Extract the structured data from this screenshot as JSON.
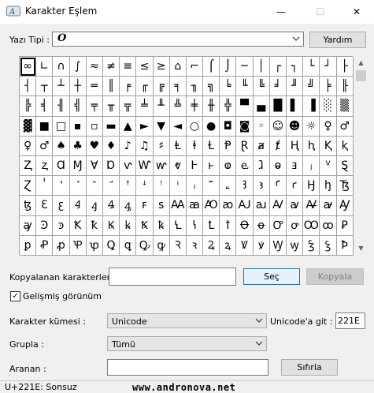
{
  "window": {
    "title": "Karakter Eşlem",
    "minimize": "—",
    "maximize": "☐",
    "close": "✕"
  },
  "font_row": {
    "label": "Yazı Tipi :",
    "font_value": "O",
    "help_button": "Yardım"
  },
  "grid": {
    "selected_index": 0,
    "chars": [
      "∞",
      "∟",
      "∩",
      "∫",
      "≈",
      "≠",
      "≡",
      "≤",
      "≥",
      "⌂",
      "⌐",
      "⌠",
      "⌡",
      "─",
      "│",
      "┌",
      "┐",
      "└",
      "┘",
      "├",
      "┤",
      "┬",
      "┴",
      "┼",
      "═",
      "║",
      "╒",
      "╓",
      "╔",
      "╕",
      "╖",
      "╗",
      "╘",
      "╙",
      "╚",
      "╛",
      "╜",
      "╝",
      "╞",
      "╟",
      "╠",
      "╡",
      "╢",
      "╣",
      "╤",
      "╥",
      "╦",
      "╧",
      "╨",
      "╩",
      "╪",
      "╫",
      "╬",
      "▀",
      "▄",
      "█",
      "▌",
      "▐",
      "░",
      "▒",
      "▓",
      "■",
      "□",
      "▪",
      "▫",
      "▬",
      "▲",
      "►",
      "▼",
      "◄",
      "○",
      "●",
      "◘",
      "◙",
      "◦",
      "☺",
      "☻",
      "☼",
      "♀",
      "♂",
      "♀",
      "♂",
      "♠",
      "♣",
      "♥",
      "♦",
      "♪",
      "♫",
      "♯",
      "Ⱡ",
      "ⱡ",
      "Ɫ",
      "Ᵽ",
      "Ɽ",
      "ⱥ",
      "ⱦ",
      "Ⱨ",
      "ⱨ",
      "Ⱪ",
      "ⱪ",
      "Ⱬ",
      "ⱬ",
      "Ɑ",
      "Ɱ",
      "Ɐ",
      "Ɒ",
      "ⱱ",
      "Ⱳ",
      "ⱳ",
      "ⱴ",
      "Ⱶ",
      "ⱶ",
      "ⱷ",
      "ⱸ",
      "ⱹ",
      "ⱺ",
      "ⱻ",
      "ⱼ",
      "ⱽ",
      "Ȿ",
      "Ɀ",
      "ⸯ",
      "ꜗ",
      "ꜘ",
      "ꜙ",
      "ꜚ",
      "ꜛ",
      "ꜜ",
      "ꜝ",
      "ꜞ",
      "ꜟ",
      "꜠",
      "꜡",
      "Ꜣ",
      "ꜣ",
      "Ꜥ",
      "ꜥ",
      "Ꜧ",
      "ꜧ",
      "Ꜩ",
      "ꜩ",
      "Ꜫ",
      "ꜫ",
      "Ꜭ",
      "ꜭ",
      "Ꜯ",
      "ꜯ",
      "ꜰ",
      "ꜱ",
      "Ꜳ",
      "ꜳ",
      "Ꜵ",
      "ꜵ",
      "Ꜷ",
      "ꜷ",
      "Ꜹ",
      "ꜹ",
      "Ꜻ",
      "ꜻ",
      "Ꜽ",
      "ꜽ",
      "Ꜿ",
      "ꜿ",
      "Ꝁ",
      "ꝁ",
      "Ꝃ",
      "ꝃ",
      "Ꝅ",
      "ꝅ",
      "Ꝇ",
      "ꝇ",
      "Ꝉ",
      "ꝉ",
      "Ꝋ",
      "ꝋ",
      "Ꝍ",
      "ꝍ",
      "Ꝏ",
      "ꝏ",
      "Ꝑ",
      "ꝑ",
      "Ꝓ",
      "ꝓ",
      "Ꝕ",
      "ꝕ",
      "Ꝗ",
      "ꝗ",
      "Ꝙ",
      "ꝙ",
      "Ꝛ",
      "ꝛ",
      "Ꝝ",
      "ꝝ",
      "Ꝟ",
      "ꝟ",
      "Ꝡ",
      "ꝡ",
      "Ꝣ",
      "ꝣ",
      "Ꝥ"
    ]
  },
  "copy_row": {
    "label": "Kopyalanan karakterler :",
    "value": "",
    "select_button": "Seç",
    "copy_button": "Kopyala"
  },
  "advanced": {
    "label": "Gelişmiş görünüm",
    "checked": true,
    "check_mark": "✓"
  },
  "charset": {
    "label": "Karakter kümesi :",
    "value": "Unicode",
    "goto_label": "Unicode'a git :",
    "goto_value": "221E"
  },
  "group": {
    "label": "Grupla :",
    "value": "Tümü"
  },
  "search": {
    "label": "Aranan :",
    "value": "",
    "button": "Sıfırla"
  },
  "status": {
    "text": "U+221E: Sonsuz",
    "watermark": "www.andronova.net"
  }
}
